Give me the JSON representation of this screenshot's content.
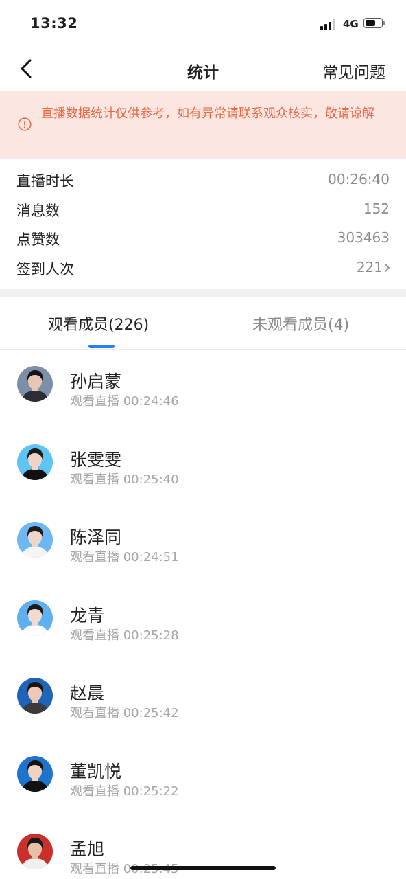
{
  "status_bar": {
    "time": "13:32",
    "network": "4G"
  },
  "nav": {
    "title": "统计",
    "right_link": "常见问题",
    "back_icon": "chevron-left-icon"
  },
  "notice": {
    "icon": "alert-circle-icon",
    "text": "直播数据统计仅供参考，如有异常请联系观众核实，敬请谅解",
    "color": "#ea6a45",
    "background": "#fbe6e1"
  },
  "stats": [
    {
      "label": "直播时长",
      "value": "00:26:40"
    },
    {
      "label": "消息数",
      "value": "152"
    },
    {
      "label": "点赞数",
      "value": "303463"
    },
    {
      "label": "签到人次",
      "value": "221"
    }
  ],
  "tabs": [
    {
      "label": "观看成员(226)",
      "active": true
    },
    {
      "label": "未观看成员(4)",
      "active": false
    }
  ],
  "accent_color": "#2a7ff5",
  "members": [
    {
      "name": "孙启蒙",
      "status": "观看直播 00:24:46",
      "avatar_bg": "#7d8fa8",
      "hair": "#151515",
      "skin": "#e8c6b4",
      "clothes": "#2c2c34"
    },
    {
      "name": "张雯雯",
      "status": "观看直播 00:25:40",
      "avatar_bg": "#5fc4f3",
      "hair": "#1b1b1b",
      "skin": "#f1d3c6",
      "clothes": "#111111"
    },
    {
      "name": "陈泽同",
      "status": "观看直播 00:24:51",
      "avatar_bg": "#6cb7f4",
      "hair": "#1d1d1d",
      "skin": "#f0d6c8",
      "clothes": "#f5f5f5"
    },
    {
      "name": "龙青",
      "status": "观看直播 00:25:28",
      "avatar_bg": "#5fb0ee",
      "hair": "#1a1a1a",
      "skin": "#f3dacd",
      "clothes": "#ffffff"
    },
    {
      "name": "赵晨",
      "status": "观看直播 00:25:42",
      "avatar_bg": "#1f64b8",
      "hair": "#1c1410",
      "skin": "#ecc9b6",
      "clothes": "#3a3a3f"
    },
    {
      "name": "董凯悦",
      "status": "观看直播 00:25:22",
      "avatar_bg": "#1e74cc",
      "hair": "#121212",
      "skin": "#f0d2c2",
      "clothes": "#111111"
    },
    {
      "name": "孟旭",
      "status": "观看直播 00:25:45",
      "avatar_bg": "#c9302b",
      "hair": "#1a1a1a",
      "skin": "#e7c0a8",
      "clothes": "#f0f0f0"
    }
  ]
}
